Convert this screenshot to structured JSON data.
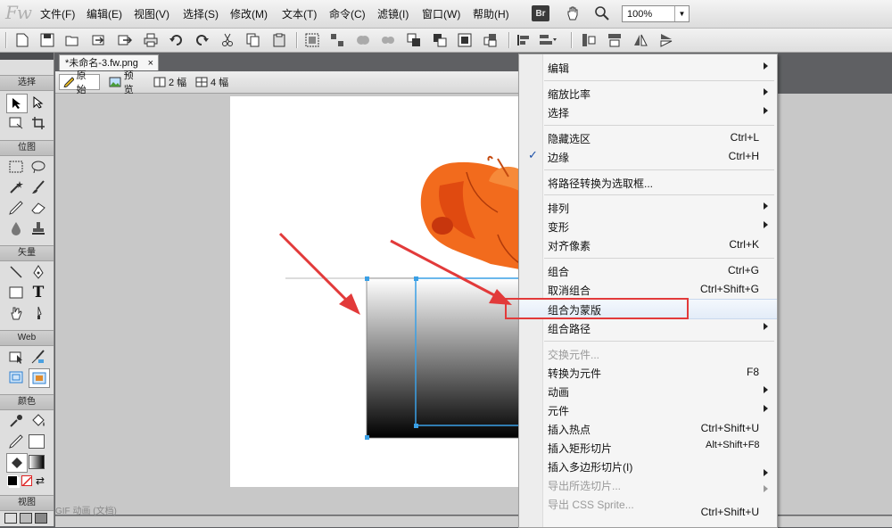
{
  "app": {
    "logo": "Fw"
  },
  "menubar": {
    "items": [
      "文件(F)",
      "编辑(E)",
      "视图(V)",
      "选择(S)",
      "修改(M)",
      "文本(T)",
      "命令(C)",
      "滤镜(I)",
      "窗口(W)",
      "帮助(H)"
    ],
    "bridge_label": "Br",
    "zoom": "100%"
  },
  "document": {
    "tab_title": "*未命名-3.fw.png",
    "tab_close": "×",
    "views": [
      "原始",
      "预览",
      "2 幅",
      "4 幅"
    ],
    "status_text": "GIF 动画 (文档)"
  },
  "toolpanel": {
    "sections": [
      "选择",
      "位图",
      "矢量",
      "Web",
      "颜色",
      "视图"
    ]
  },
  "context_menu": {
    "items": [
      {
        "label": "编辑",
        "shortcut": "",
        "submenu": true,
        "enabled": true
      },
      {
        "label": "缩放比率",
        "shortcut": "",
        "submenu": true,
        "enabled": true
      },
      {
        "label": "选择",
        "shortcut": "",
        "submenu": true,
        "enabled": true
      },
      {
        "label": "隐藏选区",
        "shortcut": "Ctrl+L",
        "submenu": false,
        "enabled": true
      },
      {
        "label": "边缘",
        "shortcut": "Ctrl+H",
        "submenu": false,
        "enabled": true,
        "checked": true
      },
      {
        "label": "将路径转换为选取框...",
        "shortcut": "",
        "submenu": false,
        "enabled": true
      },
      {
        "label": "排列",
        "shortcut": "",
        "submenu": true,
        "enabled": true
      },
      {
        "label": "变形",
        "shortcut": "",
        "submenu": true,
        "enabled": true
      },
      {
        "label": "对齐像素",
        "shortcut": "Ctrl+K",
        "submenu": false,
        "enabled": true
      },
      {
        "label": "组合",
        "shortcut": "Ctrl+G",
        "submenu": false,
        "enabled": true
      },
      {
        "label": "取消组合",
        "shortcut": "Ctrl+Shift+G",
        "submenu": false,
        "enabled": true
      },
      {
        "label": "组合为蒙版",
        "shortcut": "",
        "submenu": false,
        "enabled": true,
        "highlighted": true
      },
      {
        "label": "组合路径",
        "shortcut": "",
        "submenu": true,
        "enabled": true
      },
      {
        "label": "交换元件...",
        "shortcut": "",
        "submenu": false,
        "enabled": false
      },
      {
        "label": "转换为元件",
        "shortcut": "F8",
        "submenu": false,
        "enabled": true
      },
      {
        "label": "动画",
        "shortcut": "",
        "submenu": true,
        "enabled": true
      },
      {
        "label": "元件",
        "shortcut": "",
        "submenu": true,
        "enabled": true
      },
      {
        "label": "插入热点",
        "shortcut": "Ctrl+Shift+U",
        "submenu": false,
        "enabled": true
      },
      {
        "label": "插入矩形切片",
        "shortcut": "Alt+Shift+F8",
        "submenu": false,
        "enabled": true
      },
      {
        "label": "插入多边形切片(I)",
        "shortcut": "",
        "submenu": true,
        "enabled": true
      },
      {
        "label": "导出所选切片...",
        "shortcut": "",
        "submenu": false,
        "enabled": false
      },
      {
        "label": "导出 CSS Sprite...",
        "shortcut": "",
        "submenu": true,
        "enabled": false
      }
    ],
    "extra_shortcut": "Ctrl+Shift+U"
  },
  "colors": {
    "annotation_red": "#e23a3a",
    "selection_blue": "#3aa0e6",
    "squirrel_orange": "#f26b1d"
  }
}
